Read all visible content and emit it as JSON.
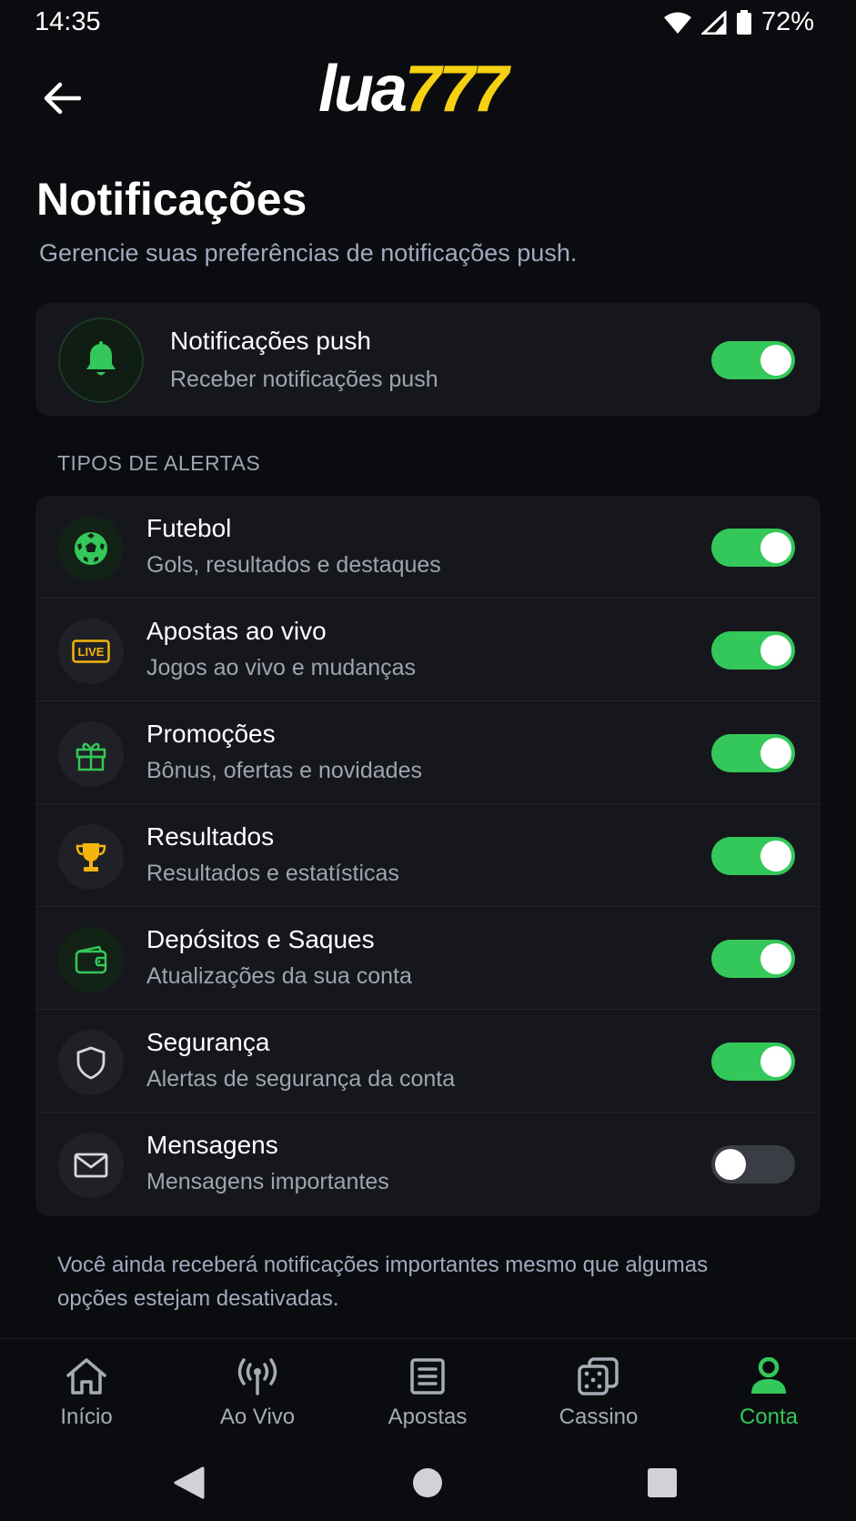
{
  "status_bar": {
    "time": "14:35",
    "battery": "72%"
  },
  "header": {
    "logo_white": "lua",
    "logo_yellow": "777",
    "title": "Notificações",
    "subtitle": "Gerencie suas preferências de notificações push."
  },
  "push": {
    "title": "Notificações push",
    "subtitle": "Receber notificações push",
    "enabled": true
  },
  "section_label": "TIPOS DE ALERTAS",
  "alerts": [
    {
      "title": "Futebol",
      "subtitle": "Gols, resultados e destaques",
      "icon": "soccer-ball-icon",
      "enabled": true
    },
    {
      "title": "Apostas ao vivo",
      "subtitle": "Jogos ao vivo e mudanças",
      "icon": "live-badge-icon",
      "enabled": true
    },
    {
      "title": "Promoções",
      "subtitle": "Bônus, ofertas e novidades",
      "icon": "gift-icon",
      "enabled": true
    },
    {
      "title": "Resultados",
      "subtitle": "Resultados e estatísticas",
      "icon": "trophy-icon",
      "enabled": true
    },
    {
      "title": "Depósitos e Saques",
      "subtitle": "Atualizações da sua conta",
      "icon": "wallet-icon",
      "enabled": true
    },
    {
      "title": "Segurança",
      "subtitle": "Alertas de segurança da conta",
      "icon": "shield-icon",
      "enabled": true
    },
    {
      "title": "Mensagens",
      "subtitle": "Mensagens importantes",
      "icon": "envelope-icon",
      "enabled": false
    }
  ],
  "footer_note": "Você ainda receberá notificações importantes mesmo que algumas opções estejam desativadas.",
  "bottom_nav": [
    {
      "label": "Início",
      "icon": "home-icon",
      "active": false
    },
    {
      "label": "Ao Vivo",
      "icon": "broadcast-icon",
      "active": false
    },
    {
      "label": "Apostas",
      "icon": "betslip-icon",
      "active": false
    },
    {
      "label": "Cassino",
      "icon": "dice-icon",
      "active": false
    },
    {
      "label": "Conta",
      "icon": "user-icon",
      "active": true
    }
  ],
  "colors": {
    "accent_green": "#34c759",
    "logo_yellow": "#f5d112",
    "background": "#0b0c0f",
    "card": "#15171c"
  }
}
